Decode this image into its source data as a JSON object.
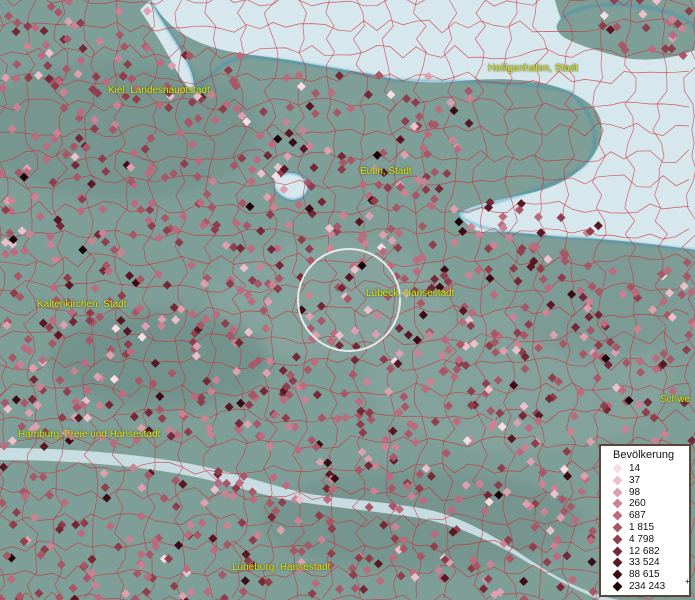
{
  "map": {
    "colors": {
      "land": "#7e9e98",
      "land_dark": "#6e8f88",
      "water": "#d6e8ee",
      "water_edge": "#2d8eb8",
      "boundary": "#d1262f",
      "label": "#e8e41a",
      "selection_ring": "#f2f2f2"
    },
    "places": [
      {
        "id": "heiligenhafen",
        "name": "Heiligenhafen, Stadt"
      },
      {
        "id": "kiel",
        "name": "Kiel, Landeshauptstadt"
      },
      {
        "id": "eutin",
        "name": "Eutin, Stadt"
      },
      {
        "id": "kaltenkirchen",
        "name": "Kaltenkirchen, Stadt"
      },
      {
        "id": "luebeck",
        "name": "Lübeck, Hansestadt"
      },
      {
        "id": "hamburg",
        "name": "Hamburg, Freie und Hansestadt"
      },
      {
        "id": "lueneburg",
        "name": "Lüneburg, Hansestadt"
      },
      {
        "id": "schwerin",
        "name": "Schwe"
      }
    ]
  },
  "legend": {
    "title": "Bevölkerung",
    "classes": [
      {
        "label": "14",
        "color": "#f6dde4"
      },
      {
        "label": "37",
        "color": "#ecc0cb"
      },
      {
        "label": "98",
        "color": "#dca0ae"
      },
      {
        "label": "260",
        "color": "#cb8393"
      },
      {
        "label": "687",
        "color": "#bb6b7d"
      },
      {
        "label": "1 815",
        "color": "#a85766"
      },
      {
        "label": "4 798",
        "color": "#8f3e4c"
      },
      {
        "label": "12 682",
        "color": "#752836"
      },
      {
        "label": "33 524",
        "color": "#5a1724"
      },
      {
        "label": "88 615",
        "color": "#3d0b14"
      },
      {
        "label": "234 243",
        "color": "#1a0306"
      }
    ],
    "overflow_marker": "+"
  }
}
